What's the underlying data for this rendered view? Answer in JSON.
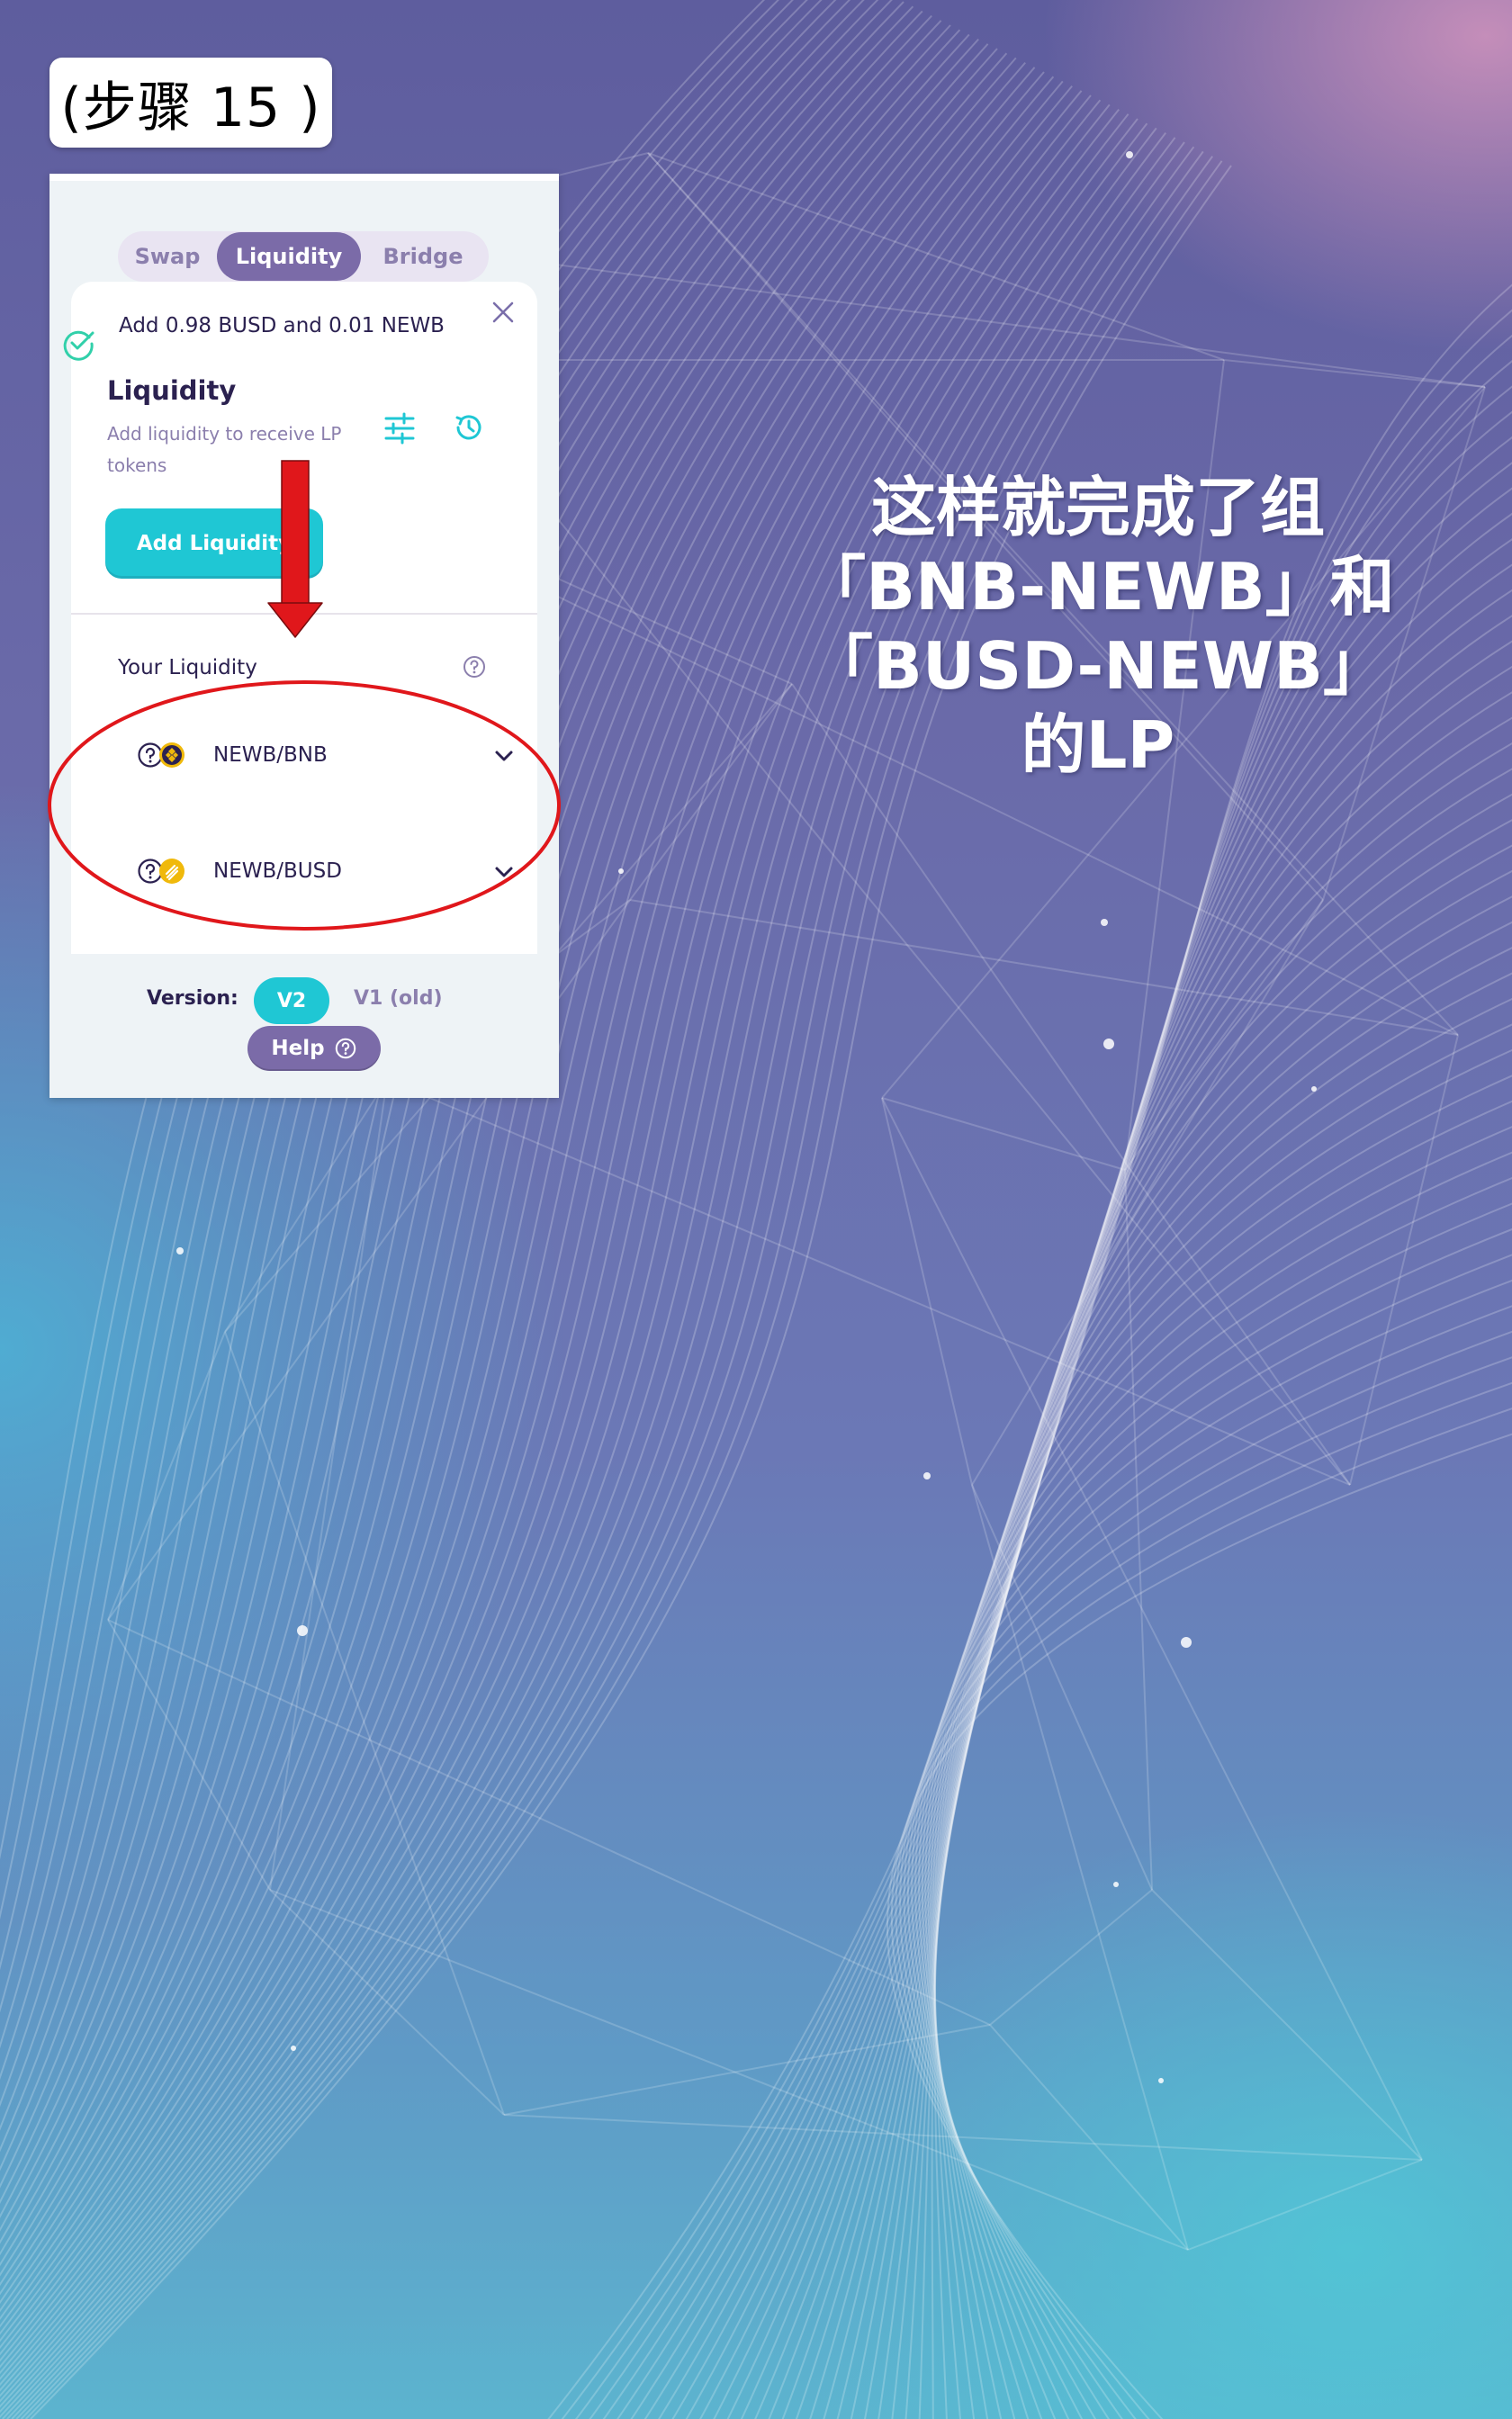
{
  "step_label": "(步骤 15 )",
  "tabs": [
    {
      "label": "Swap",
      "active": false
    },
    {
      "label": "Liquidity",
      "active": true
    },
    {
      "label": "Bridge",
      "active": false
    }
  ],
  "toast": {
    "message": "Add 0.98 BUSD and 0.01 NEWB",
    "status_color": "#31d0aa"
  },
  "liquidity": {
    "title": "Liquidity",
    "subtitle": "Add liquidity to receive LP tokens",
    "add_button": "Add Liquidity",
    "your_liquidity_label": "Your Liquidity",
    "pairs": [
      {
        "label": "NEWB/BNB",
        "token_icon": "bnb-icon"
      },
      {
        "label": "NEWB/BUSD",
        "token_icon": "busd-icon"
      }
    ]
  },
  "footer": {
    "version_label": "Version:",
    "v2_label": "V2",
    "v1_label": "V1 (old)",
    "help_label": "Help"
  },
  "heading_lines": [
    "这样就完成了组",
    "「BNB-NEWB」和",
    "「BUSD-NEWB」",
    "的LP"
  ],
  "colors": {
    "accent": "#1fc7d4",
    "secondary": "#7b6ba8",
    "text_primary": "#2b2150",
    "text_secondary": "#8b7fad",
    "annotation_red": "#e0171b"
  }
}
